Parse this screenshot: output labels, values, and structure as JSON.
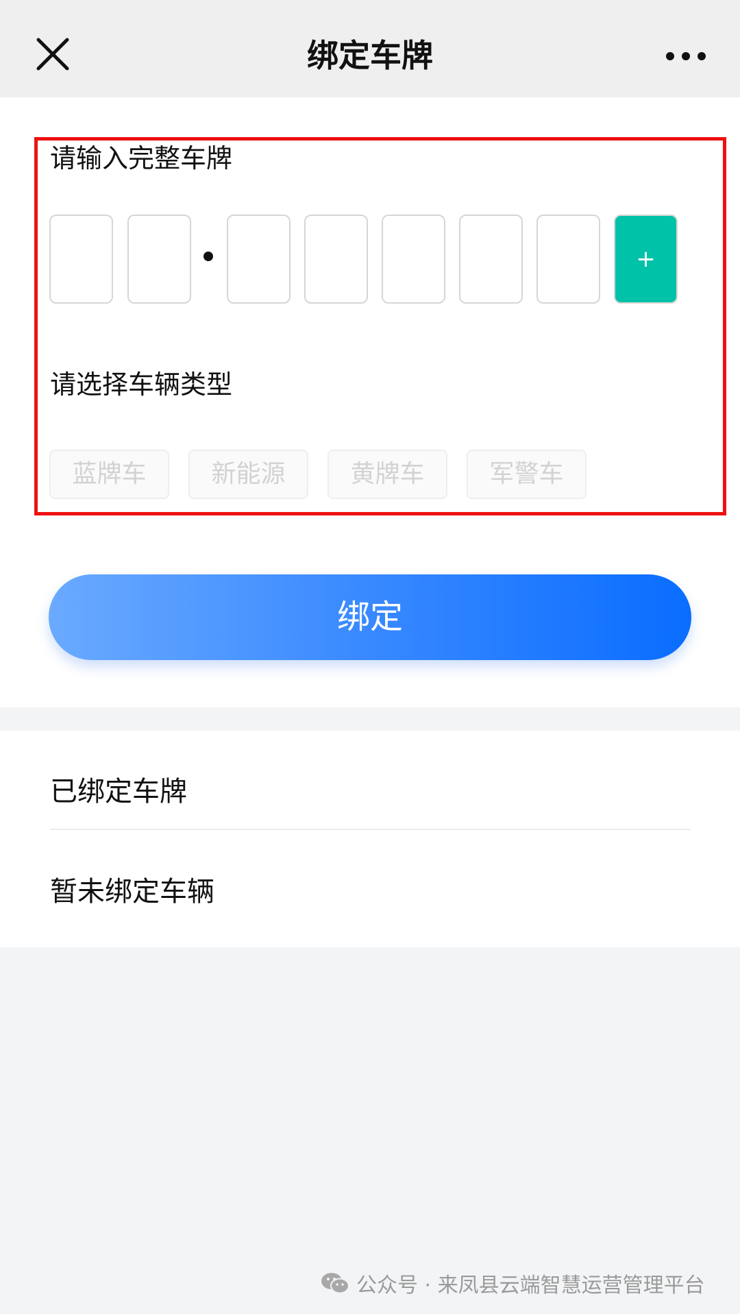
{
  "nav": {
    "title": "绑定车牌",
    "close_icon": "close-icon",
    "more_icon": "more-dots-icon"
  },
  "form": {
    "plate_label": "请输入完整车牌",
    "plate_slots": [
      "",
      "",
      "",
      "",
      "",
      "",
      ""
    ],
    "add_slot_label": "+",
    "type_label": "请选择车辆类型",
    "vehicle_types": [
      "蓝牌车",
      "新能源",
      "黄牌车",
      "军警车"
    ],
    "bind_label": "绑定"
  },
  "bound": {
    "title": "已绑定车牌",
    "empty_text": "暂未绑定车辆"
  },
  "watermark": {
    "icon": "wechat-icon",
    "text": "公众号 · 来凤县云端智慧运营管理平台"
  },
  "colors": {
    "accent_teal": "#00c2a8",
    "button_gradient_start": "#6aaaff",
    "button_gradient_end": "#0a6dff",
    "highlight_border": "#ee1111"
  }
}
